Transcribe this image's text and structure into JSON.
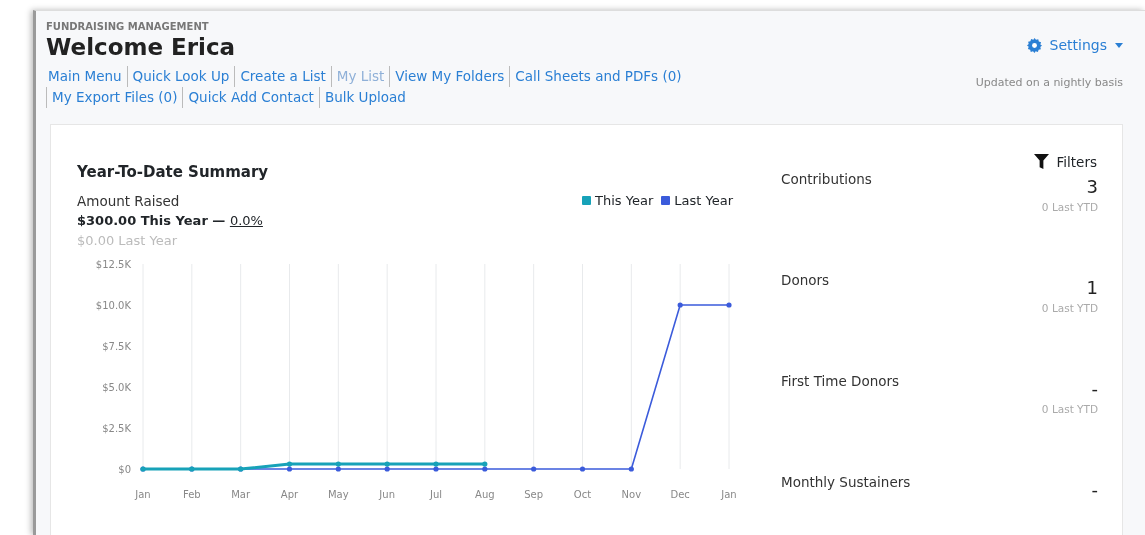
{
  "header": {
    "section": "FUNDRAISING MANAGEMENT",
    "title": "Welcome Erica",
    "settings": "Settings",
    "note": "Updated on a nightly basis"
  },
  "links": [
    {
      "label": "Main Menu",
      "disabled": false
    },
    {
      "label": "Quick Look Up",
      "disabled": false
    },
    {
      "label": "Create a List",
      "disabled": false
    },
    {
      "label": "My List",
      "disabled": true
    },
    {
      "label": "View My Folders",
      "disabled": false
    },
    {
      "label": "Call Sheets and PDFs (0)",
      "disabled": false
    },
    {
      "label": "My Export Files (0)",
      "disabled": false
    },
    {
      "label": "Quick Add Contact",
      "disabled": false
    },
    {
      "label": "Bulk Upload",
      "disabled": false
    }
  ],
  "summary": {
    "title": "Year-To-Date Summary",
    "metric": "Amount Raised",
    "this_year": "$300.00 This Year",
    "dash": "—",
    "change": "0.0%",
    "last_year": "$0.00 Last Year",
    "chart_data": {
      "type": "line",
      "categories": [
        "Jan",
        "Feb",
        "Mar",
        "Apr",
        "May",
        "Jun",
        "Jul",
        "Aug",
        "Sep",
        "Oct",
        "Nov",
        "Dec",
        "Jan"
      ],
      "series": [
        {
          "name": "This Year",
          "color": "#17a2b8",
          "values": [
            0,
            0,
            0,
            300,
            300,
            300,
            300,
            300,
            null,
            null,
            null,
            null,
            null
          ]
        },
        {
          "name": "Last Year",
          "color": "#3b5bdb",
          "values": [
            0,
            0,
            0,
            0,
            0,
            0,
            0,
            0,
            0,
            0,
            0,
            10000,
            10000
          ]
        }
      ],
      "grid": true,
      "ylim": [
        0,
        12500
      ],
      "yticks": [
        {
          "value": 0,
          "label": "$0"
        },
        {
          "value": 2500,
          "label": "$2.5K"
        },
        {
          "value": 5000,
          "label": "$5.0K"
        },
        {
          "value": 7500,
          "label": "$7.5K"
        },
        {
          "value": 10000,
          "label": "$10.0K"
        },
        {
          "value": 12500,
          "label": "$12.5K"
        }
      ]
    }
  },
  "filters": "Filters",
  "stats": [
    {
      "label": "Contributions",
      "value": "3",
      "previous": "0 Last YTD"
    },
    {
      "label": "Donors",
      "value": "1",
      "previous": "0 Last YTD"
    },
    {
      "label": "First Time Donors",
      "value": "-",
      "previous": "0 Last YTD"
    },
    {
      "label": "Monthly Sustainers",
      "value": "-"
    }
  ]
}
